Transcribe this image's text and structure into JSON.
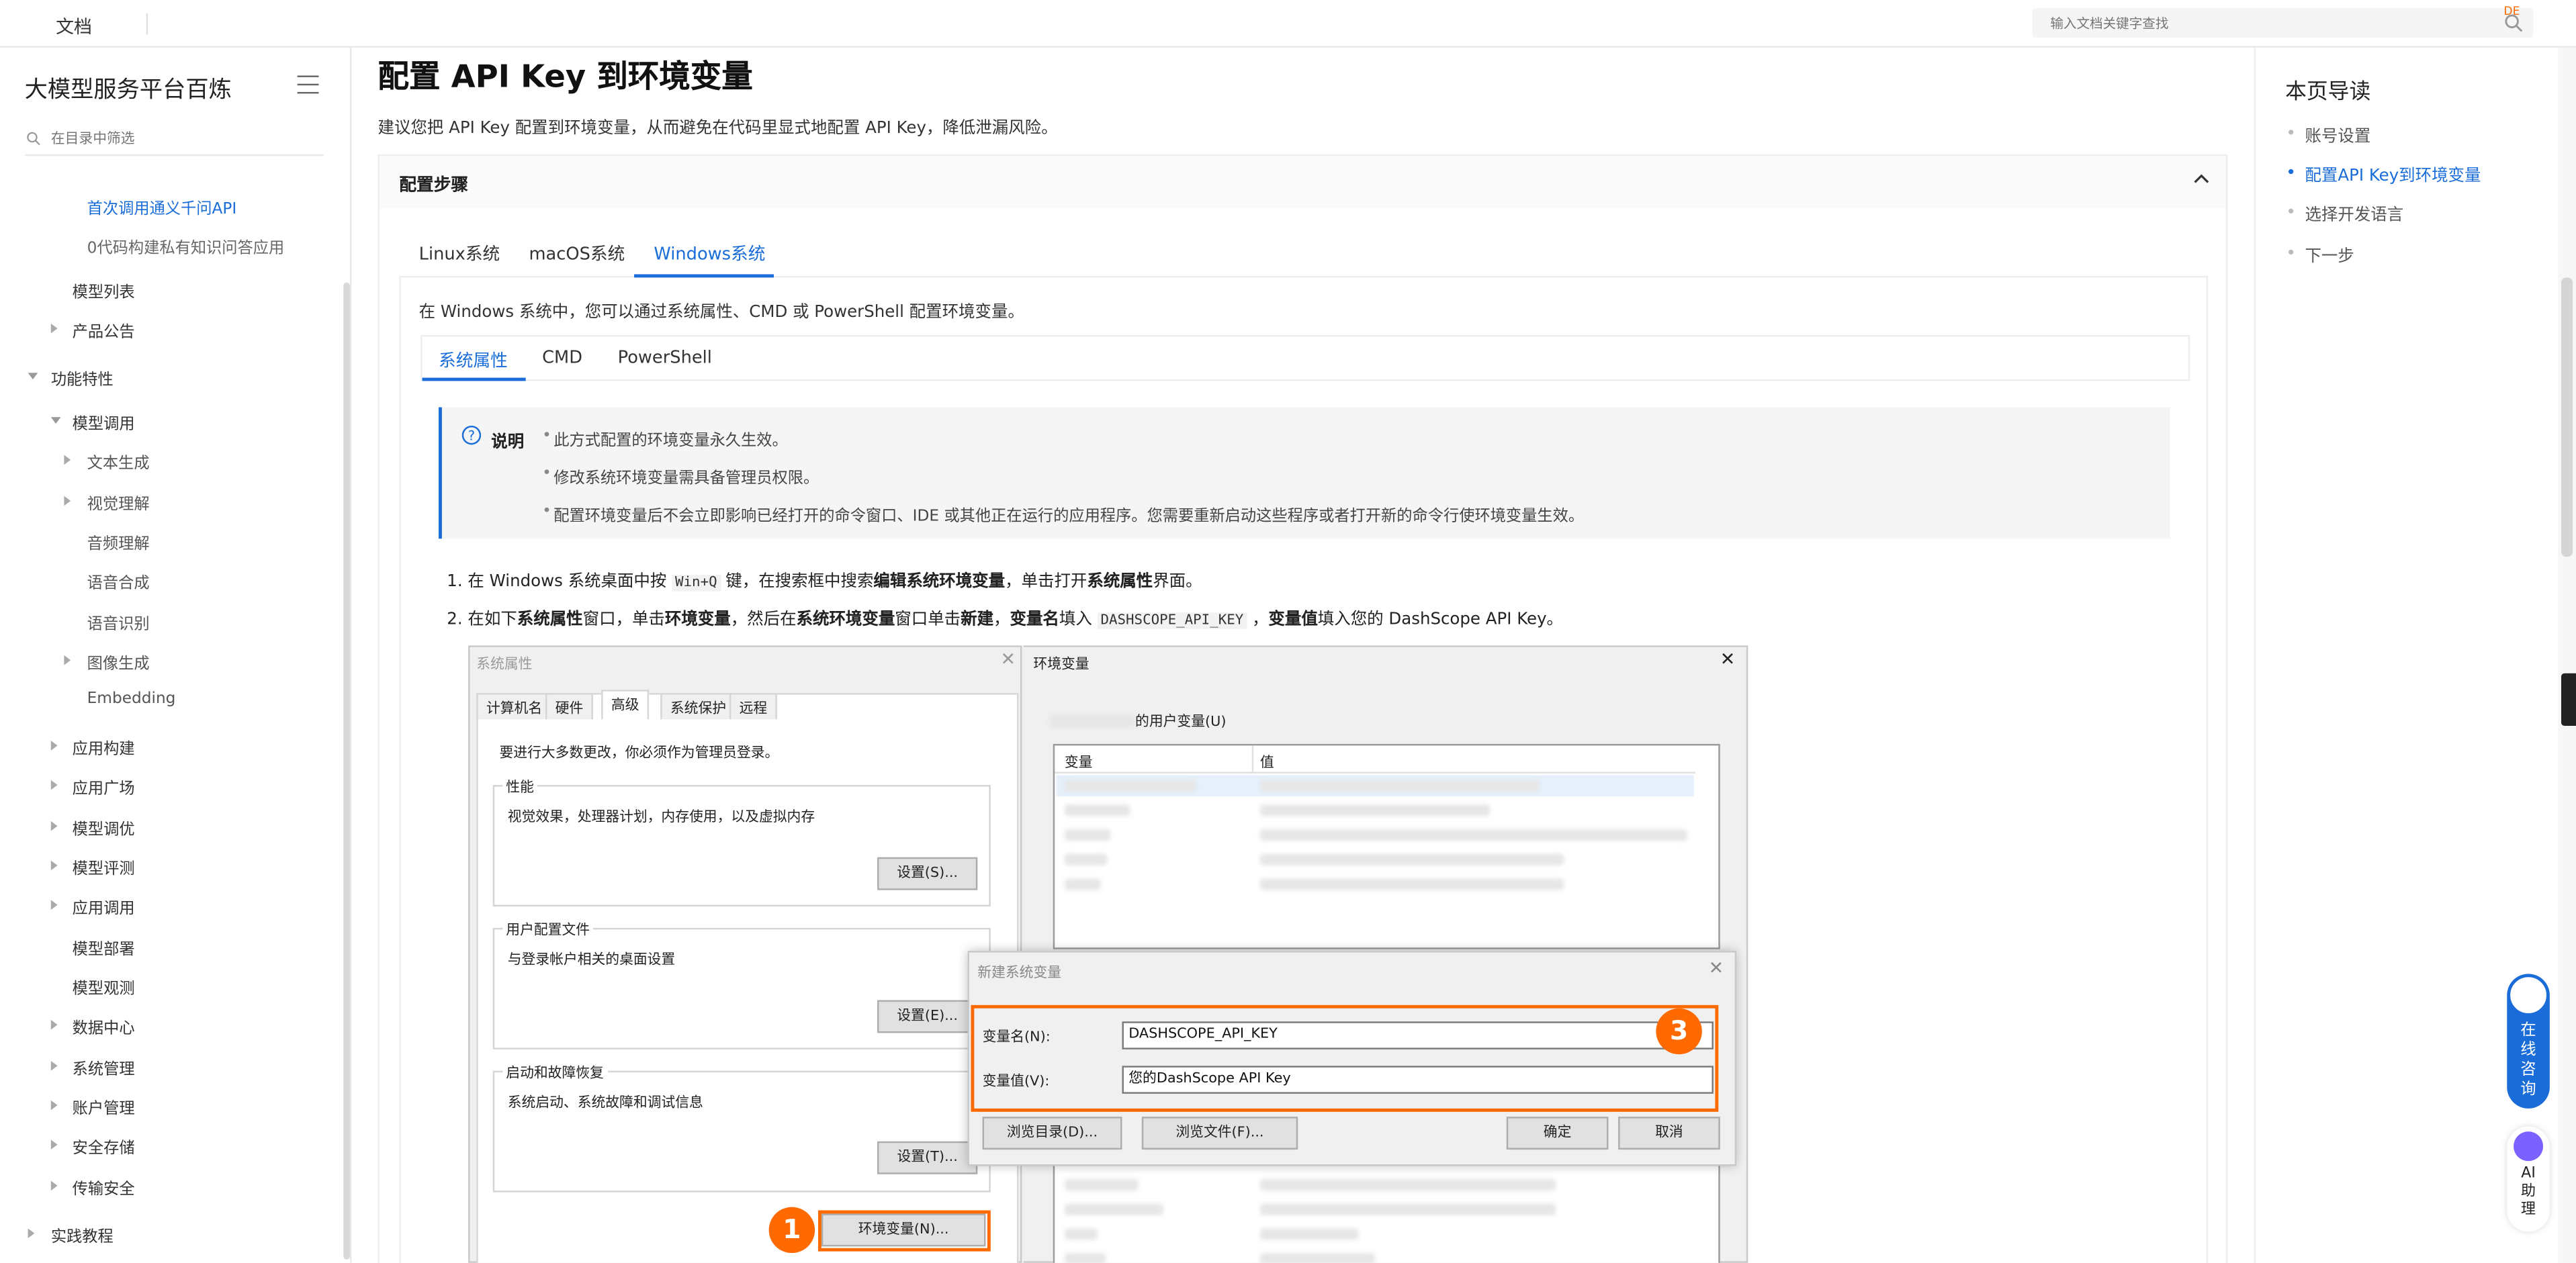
{
  "topbar": {
    "docs_label": "文档",
    "search_placeholder": "输入文档关键字查找",
    "de_badge": "DE"
  },
  "sidebar": {
    "product_title": "大模型服务平台百炼",
    "filter_placeholder": "在目录中筛选",
    "items": [
      "首次调用通义千问API",
      "0代码构建私有知识问答应用",
      "模型列表",
      "产品公告",
      "功能特性",
      "模型调用",
      "文本生成",
      "视觉理解",
      "音频理解",
      "语音合成",
      "语音识别",
      "图像生成",
      "Embedding",
      "应用构建",
      "应用广场",
      "模型调优",
      "模型评测",
      "应用调用",
      "模型部署",
      "模型观测",
      "数据中心",
      "系统管理",
      "账户管理",
      "安全存储",
      "传输安全",
      "实践教程"
    ]
  },
  "main": {
    "title": "配置 API Key 到环境变量",
    "intro": "建议您把 API Key 配置到环境变量，从而避免在代码里显式地配置 API Key，降低泄漏风险。",
    "panel_title": "配置步骤",
    "os_tabs": [
      "Linux系统",
      "macOS系统",
      "Windows系统"
    ],
    "windows_intro": "在 Windows 系统中，您可以通过系统属性、CMD 或 PowerShell 配置环境变量。",
    "method_tabs": [
      "系统属性",
      "CMD",
      "PowerShell"
    ],
    "note": {
      "label": "说明",
      "bullets": [
        "此方式配置的环境变量永久生效。",
        "修改系统环境变量需具备管理员权限。",
        "配置环境变量后不会立即影响已经打开的命令窗口、IDE 或其他正在运行的应用程序。您需要重新启动这些程序或者打开新的命令行使环境变量生效。"
      ]
    },
    "step1": {
      "n": "1.",
      "a": "在 Windows 系统桌面中按 ",
      "code": "Win+Q",
      "b": " 键，在搜索框中搜索",
      "bold1": "编辑系统环境变量",
      "c": "，单击打开",
      "bold2": "系统属性",
      "d": "界面。"
    },
    "step2": {
      "n": "2.",
      "a": "在如下",
      "bold1": "系统属性",
      "b": "窗口，单击",
      "bold2": "环境变量",
      "c": "，然后在",
      "bold3": "系统环境变量",
      "d": "窗口单击",
      "bold4": "新建",
      "e": "，",
      "bold5": "变量名",
      "f": "填入 ",
      "code": "DASHSCOPE_API_KEY",
      "g": " ，",
      "bold6": "变量值",
      "h": "填入您的 DashScope API Key。"
    },
    "screenshot": {
      "sysprops": {
        "title": "系统属性",
        "tabs": [
          "计算机名",
          "硬件",
          "高级",
          "系统保护",
          "远程"
        ],
        "admin_note": "要进行大多数更改，你必须作为管理员登录。",
        "perf_label": "性能",
        "perf_text": "视觉效果，处理器计划，内存使用，以及虚拟内存",
        "settings_btn": "设置(S)...",
        "profile_label": "用户配置文件",
        "profile_text": "与登录帐户相关的桌面设置",
        "settings_btn2": "设置(E)...",
        "startup_label": "启动和故障恢复",
        "startup_text": "系统启动、系统故障和调试信息",
        "settings_btn3": "设置(T)...",
        "env_btn": "环境变量(N)..."
      },
      "envvars": {
        "title": "环境变量",
        "user_vars_label": "的用户变量(U)",
        "col_var": "变量",
        "col_val": "值"
      },
      "newvar": {
        "title": "新建系统变量",
        "name_label": "变量名(N):",
        "name_value": "DASHSCOPE_API_KEY",
        "value_label": "变量值(V):",
        "value_value": "您的DashScope API Key",
        "browse_dir": "浏览目录(D)...",
        "browse_file": "浏览文件(F)...",
        "ok": "确定",
        "cancel": "取消"
      },
      "badges": [
        "1",
        "3"
      ]
    }
  },
  "toc": {
    "title": "本页导读",
    "items": [
      "账号设置",
      "配置API Key到环境变量",
      "选择开发语言",
      "下一步"
    ]
  },
  "widgets": {
    "consult": "在线咨询",
    "ai_help": "AI助理"
  },
  "colors": {
    "accent": "#1a6dd8",
    "highlight": "#ff6a00"
  }
}
